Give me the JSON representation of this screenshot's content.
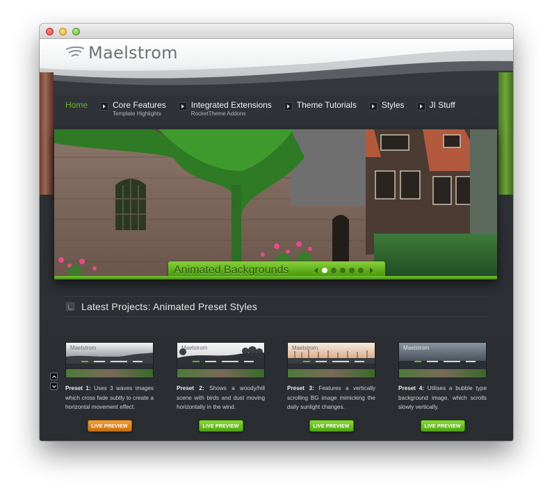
{
  "window": {
    "title": ""
  },
  "logo": {
    "text": "Maelstrom"
  },
  "nav": {
    "items": [
      {
        "label": "Home",
        "sub": "",
        "active": true
      },
      {
        "label": "Core Features",
        "sub": "Template Highlights"
      },
      {
        "label": "Integrated Extensions",
        "sub": "RocketTheme Addons"
      },
      {
        "label": "Theme Tutorials",
        "sub": ""
      },
      {
        "label": "Styles",
        "sub": ""
      },
      {
        "label": "JI Stuff",
        "sub": ""
      }
    ]
  },
  "slideshow": {
    "title": "Animated Backgrounds",
    "slide_count": 5,
    "active_slide": 1
  },
  "section": {
    "title": "Latest Projects: Animated Preset Styles"
  },
  "projects": [
    {
      "name": "Preset 1:",
      "desc": "Uses 3 waves images which cross fade subtly to create a horizontal movement effect.",
      "button": "LIVE PREVIEW",
      "button_color": "#d57f15"
    },
    {
      "name": "Preset 2:",
      "desc": "Shows a woody/hill scene with birds and dust moving horizontally in the wind.",
      "button": "LIVE PREVIEW",
      "button_color": "#5fb51c"
    },
    {
      "name": "Preset 3:",
      "desc": "Features a vertically scrolling BG image mimicking the daily sunlight changes.",
      "button": "LIVE PREVIEW",
      "button_color": "#5fb51c"
    },
    {
      "name": "Preset 4:",
      "desc": "Utilises a bubble type background image, which scrolls slowly vertically.",
      "button": "LIVE PREVIEW",
      "button_color": "#5fb51c"
    }
  ],
  "thumbs": [
    {
      "logo": "Maelstrom"
    },
    {
      "logo": "Maelstrom"
    },
    {
      "logo": "Maelstrom"
    },
    {
      "logo": "Maelstrom"
    }
  ],
  "colors": {
    "accent_green": "#69b92b",
    "background": "#2b2e33",
    "orange_button": "#d57f15"
  }
}
